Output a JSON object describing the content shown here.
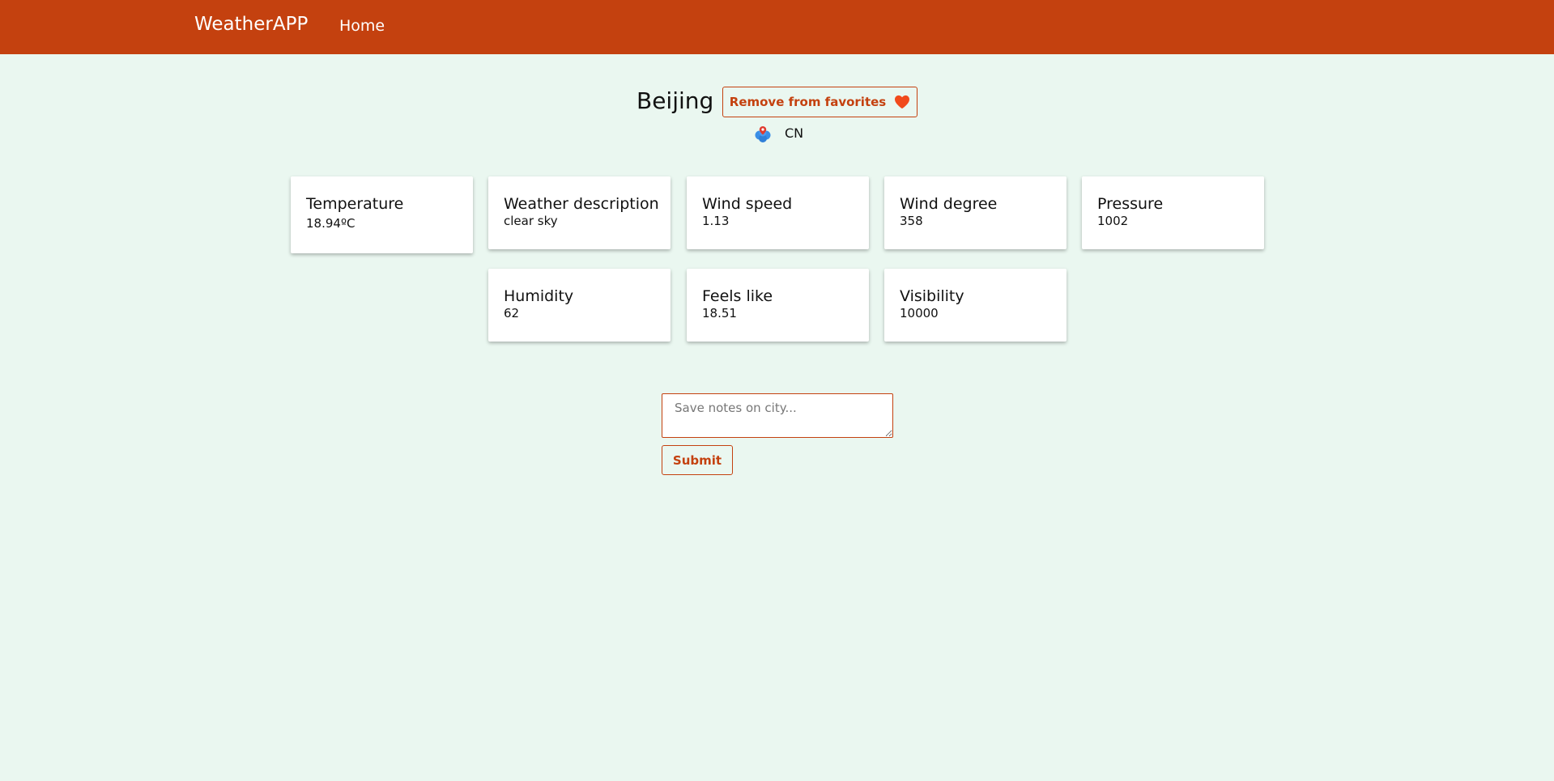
{
  "nav": {
    "brand": "WeatherAPP",
    "home": "Home"
  },
  "city": {
    "name": "Beijing",
    "favorite_button": "Remove from favorites",
    "favorite_icon": "heart-icon",
    "country_icon": "location-pin-icon",
    "country": "CN"
  },
  "cards": [
    {
      "title": "Temperature",
      "value": "18.94ºC"
    },
    {
      "title": "Weather description",
      "value": "clear sky"
    },
    {
      "title": "Wind speed",
      "value": "1.13"
    },
    {
      "title": "Wind degree",
      "value": "358"
    },
    {
      "title": "Pressure",
      "value": "1002"
    },
    {
      "title": "Humidity",
      "value": "62"
    },
    {
      "title": "Feels like",
      "value": "18.51"
    },
    {
      "title": "Visibility",
      "value": "10000"
    }
  ],
  "notes": {
    "placeholder": "Save notes on city...",
    "value": "",
    "submit": "Submit"
  },
  "colors": {
    "accent": "#c4410f",
    "background": "#eaf7f0",
    "heart": "#f14a1c",
    "card": "#ffffff"
  }
}
